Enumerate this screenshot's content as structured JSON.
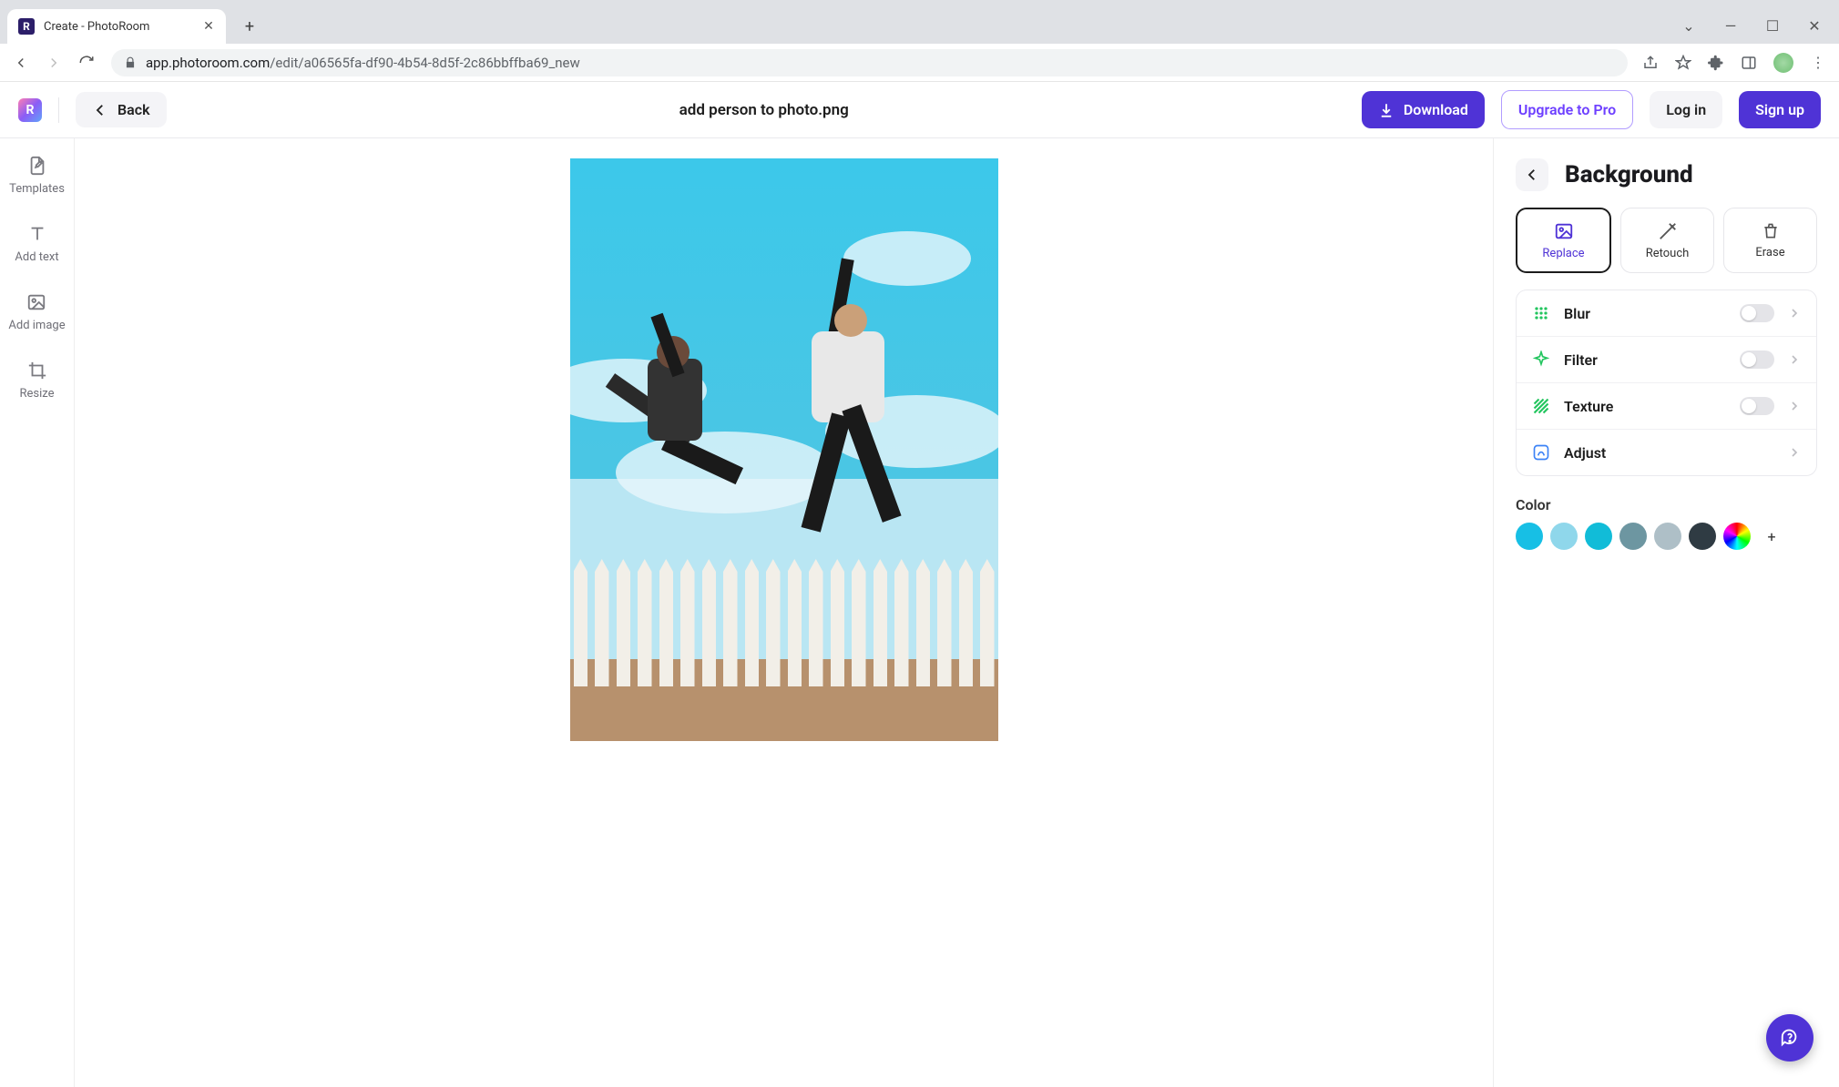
{
  "browser": {
    "tab_title": "Create - PhotoRoom",
    "url_host": "app.photoroom.com",
    "url_path": "/edit/a06565fa-df90-4b54-8d5f-2c86bbffba69_new"
  },
  "header": {
    "back_label": "Back",
    "filename": "add person to photo.png",
    "download_label": "Download",
    "upgrade_label": "Upgrade to Pro",
    "login_label": "Log in",
    "signup_label": "Sign up"
  },
  "rail": {
    "items": [
      {
        "id": "templates",
        "label": "Templates"
      },
      {
        "id": "addtext",
        "label": "Add text"
      },
      {
        "id": "addimage",
        "label": "Add image"
      },
      {
        "id": "resize",
        "label": "Resize"
      }
    ]
  },
  "panel": {
    "title": "Background",
    "actions": [
      {
        "id": "replace",
        "label": "Replace",
        "active": true
      },
      {
        "id": "retouch",
        "label": "Retouch",
        "active": false
      },
      {
        "id": "erase",
        "label": "Erase",
        "active": false
      }
    ],
    "options": [
      {
        "id": "blur",
        "label": "Blur",
        "toggle": false
      },
      {
        "id": "filter",
        "label": "Filter",
        "toggle": false
      },
      {
        "id": "texture",
        "label": "Texture",
        "toggle": false
      },
      {
        "id": "adjust",
        "label": "Adjust",
        "toggle": null
      }
    ],
    "color_title": "Color",
    "swatches": [
      "#17bfe5",
      "#8fd7eb",
      "#11bcd8",
      "#6d96a1",
      "#aebfc7",
      "#2f3b43"
    ]
  }
}
